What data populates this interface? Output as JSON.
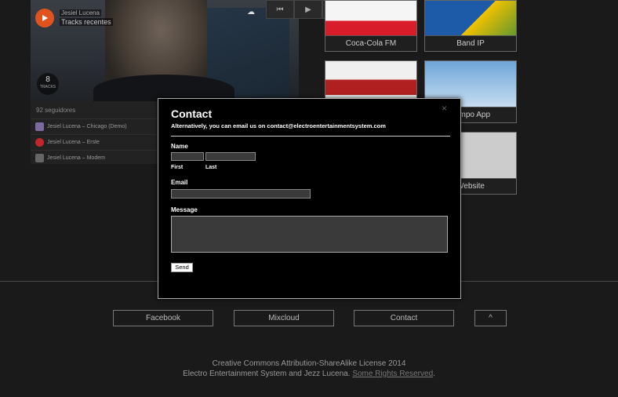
{
  "soundcloud": {
    "user": "Jesiel Lucena",
    "title": "Tracks recentes",
    "logo": "☁",
    "tracks_count": "8",
    "tracks_label": "TRACKS",
    "followers": "92 seguidores",
    "tracks": [
      {
        "label": "Jesiel Lucena – Chicago (Demo)",
        "thumb_color": "#7a6aa0"
      },
      {
        "label": "Jesiel Lucena – Erste",
        "thumb_color": "#c0262a"
      },
      {
        "label": "Jesiel Lucena – Modem",
        "thumb_color": "#666666"
      }
    ]
  },
  "player": {
    "prev_icon": "⏮",
    "play_icon": "▶",
    "next_icon": "⏭"
  },
  "tiles": [
    {
      "caption": "Coca-Cola FM",
      "colors": [
        "#f5f5f5",
        "#d91c2a"
      ]
    },
    {
      "caption": "Band IP",
      "colors": [
        "#1d5aa8",
        "#f2c200"
      ]
    },
    {
      "caption": "",
      "colors": [
        "#f0f0f0",
        "#b02020"
      ]
    },
    {
      "caption": "Tempo App",
      "colors": [
        "#6fa6d8",
        "#e8eef5"
      ]
    },
    {
      "caption": "Website",
      "colors": [
        "#cccccc",
        "#cccccc"
      ]
    }
  ],
  "modal": {
    "close": "×",
    "title": "Contact",
    "subtitle": "Alternatively, you can email us on contact@electroentertainmentsystem.com",
    "name_label": "Name",
    "first_label": "First",
    "last_label": "Last",
    "email_label": "Email",
    "message_label": "Message",
    "send_label": "Send"
  },
  "footer": {
    "buttons": [
      "Facebook",
      "Mixcloud",
      "Contact",
      "^"
    ],
    "license": "Creative Commons Attribution-ShareAlike License 2014",
    "credit": "Electro Entertainment System and Jezz Lucena.",
    "rights_link": "Some Rights Reserved",
    "credit_end": "."
  }
}
